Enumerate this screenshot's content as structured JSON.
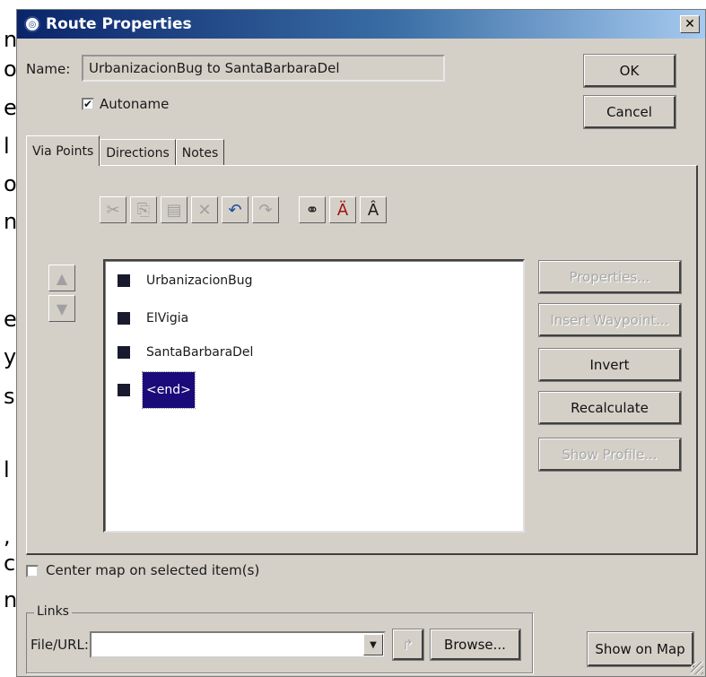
{
  "side_text": [
    "n",
    "o",
    "e",
    "l",
    "o",
    "n",
    "e",
    "y",
    "s",
    "l",
    ",",
    "c",
    "n"
  ],
  "window": {
    "title": "Route Properties",
    "close_glyph": "✕"
  },
  "name": {
    "label": "Name:",
    "value": "UrbanizacionBug to SantaBarbaraDel"
  },
  "autoname": {
    "label": "Autoname",
    "checked": true
  },
  "buttons": {
    "ok": "OK",
    "cancel": "Cancel"
  },
  "tabs": [
    {
      "label": "Via Points",
      "active": true
    },
    {
      "label": "Directions",
      "active": false
    },
    {
      "label": "Notes",
      "active": false
    }
  ],
  "toolbar_icons": [
    "cut-icon",
    "copy-icon",
    "paste-icon",
    "delete-icon",
    "undo-icon",
    "redo-icon",
    "find-icon",
    "find-next-icon",
    "find-previous-icon"
  ],
  "via_points": [
    {
      "name": "UrbanizacionBug",
      "selected": false
    },
    {
      "name": "ElVigia",
      "selected": false
    },
    {
      "name": "SantaBarbaraDel",
      "selected": false
    },
    {
      "name": "<end>",
      "selected": true
    }
  ],
  "side_buttons": {
    "properties": "Properties...",
    "insert_waypoint": "Insert Waypoint...",
    "invert": "Invert",
    "recalculate": "Recalculate",
    "show_profile": "Show Profile..."
  },
  "center_map": {
    "label": "Center map on selected item(s)",
    "checked": false
  },
  "links": {
    "legend": "Links",
    "file_url_label": "File/URL:",
    "file_url_value": "",
    "browse_label": "Browse..."
  },
  "show_on_map": "Show on Map",
  "colors": {
    "dialog_bg": "#d4d0c8",
    "title_gradient_start": "#0a246a",
    "selection": "#1a0a7a"
  }
}
